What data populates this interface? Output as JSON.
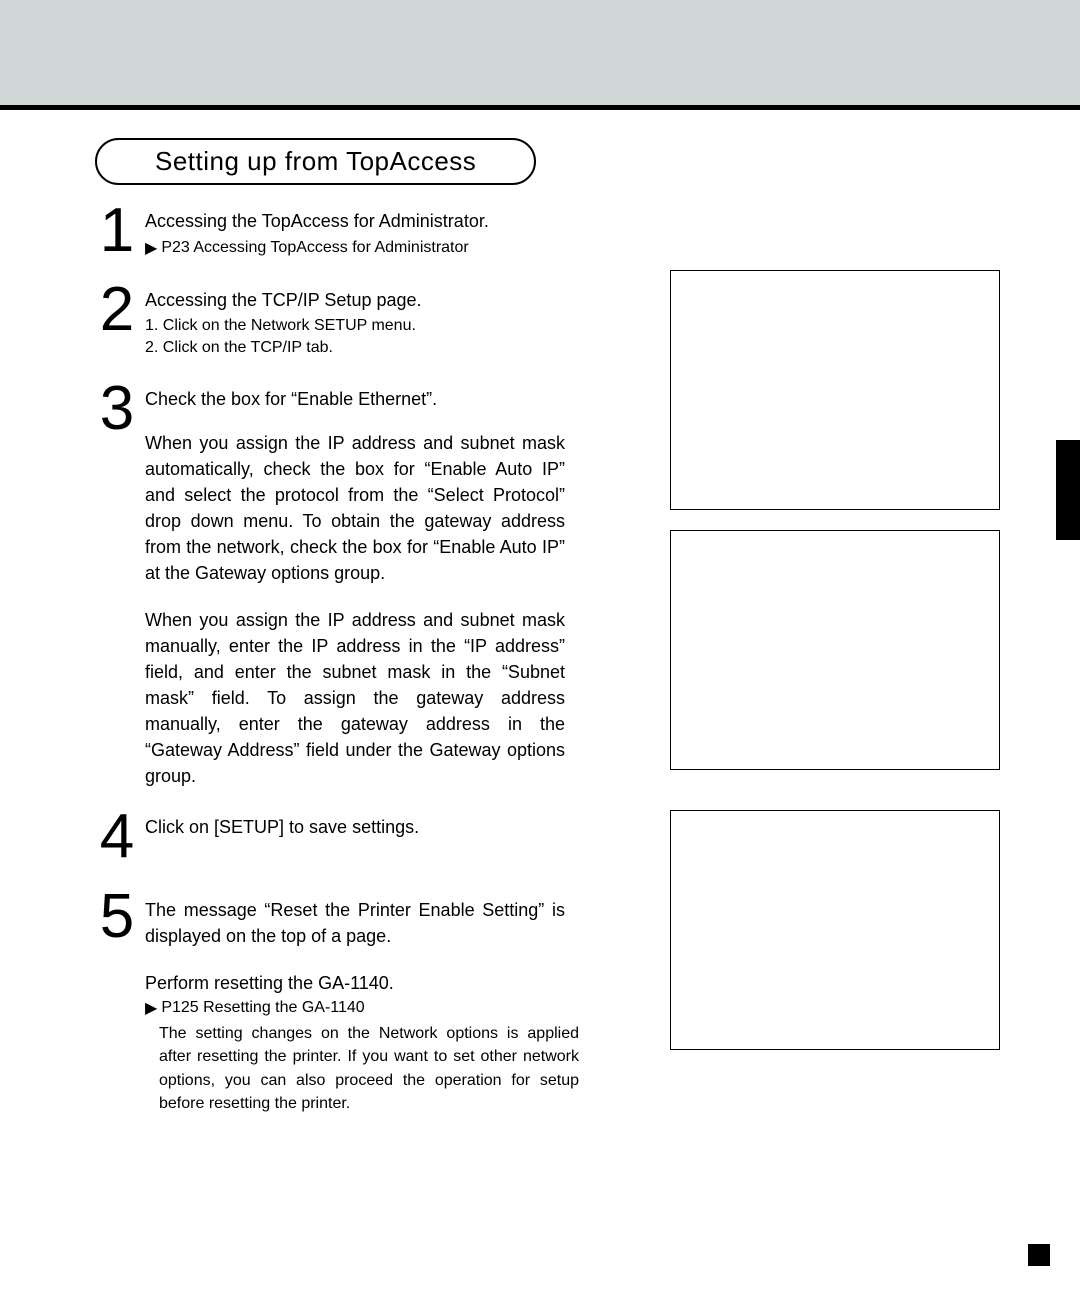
{
  "title": "Setting up from TopAccess",
  "steps": [
    {
      "num": "1",
      "heading": "Accessing the TopAccess for Administrator.",
      "ref": "P23  Accessing TopAccess for Administrator"
    },
    {
      "num": "2",
      "heading": "Accessing the TCP/IP Setup page.",
      "sublist": [
        "1.   Click on the Network SETUP menu.",
        "2.   Click on the TCP/IP tab."
      ]
    },
    {
      "num": "3",
      "heading": "Check the box for “Enable Ethernet”.",
      "para1": "When you assign the IP address and subnet mask automatically, check the box for “Enable Auto IP” and select the protocol from the “Select Protocol” drop down menu. To obtain the gateway address from the network, check the box for “Enable Auto IP” at the Gateway options group.",
      "para2": "When you assign the IP address and subnet mask manually, enter the IP address in the “IP address” field, and enter the subnet mask in the “Subnet mask” field. To assign the gateway address manually, enter the gateway address in the “Gateway Address” field under the Gateway options group."
    },
    {
      "num": "4",
      "heading": "Click on [SETUP] to save settings."
    },
    {
      "num": "5",
      "heading": "The message “Reset the Printer Enable Setting” is displayed on the top of a page.",
      "extra_line": "Perform resetting the GA-1140.",
      "ref": "P125  Resetting the GA-1140",
      "note": "The setting changes on the Network options is applied after resetting the printer.  If you want to set other network options, you can also proceed the operation for setup before resetting the printer."
    }
  ]
}
